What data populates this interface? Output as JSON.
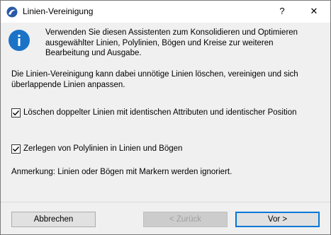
{
  "window": {
    "title": "Linien-Vereinigung",
    "help_label": "?",
    "close_label": "✕"
  },
  "intro": "Verwenden Sie diesen Assistenten zum Konsolidieren und Optimieren ausgewählter Linien, Polylinien, Bögen und Kreise zur weiteren Bearbeitung und Ausgabe.",
  "description": "Die Linien-Vereinigung kann dabei unnötige Linien löschen, vereinigen und sich überlappende Linien anpassen.",
  "options": [
    {
      "label": "Löschen doppelter Linien mit identischen Attributen und identischer Position",
      "checked": true
    },
    {
      "label": "Zerlegen von Polylinien in Linien und Bögen",
      "checked": true
    }
  ],
  "note": "Anmerkung: Linien oder Bögen mit Markern werden ignoriert.",
  "buttons": {
    "cancel": "Abbrechen",
    "back": "< Zurück",
    "next": "Vor >"
  },
  "colors": {
    "info_icon": "#1a73c7",
    "default_button_border": "#0078d7"
  }
}
